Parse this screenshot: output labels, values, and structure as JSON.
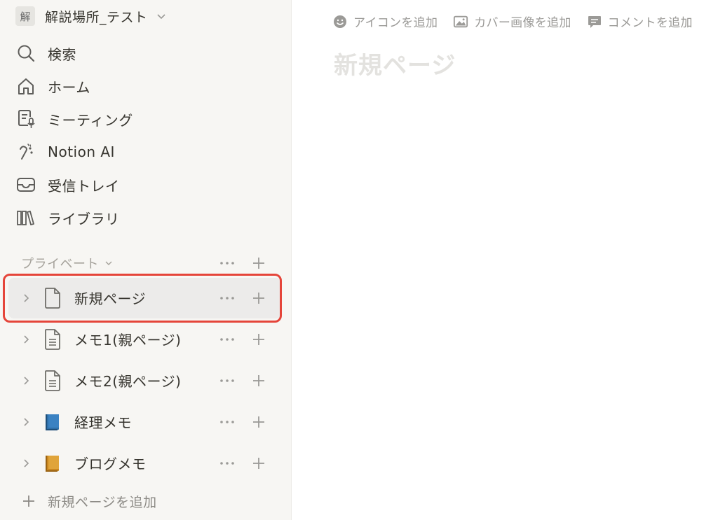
{
  "workspace": {
    "badge": "解",
    "name": "解説場所_テスト"
  },
  "nav": {
    "search": "検索",
    "home": "ホーム",
    "meetings": "ミーティング",
    "notion_ai": "Notion AI",
    "inbox": "受信トレイ",
    "library": "ライブラリ"
  },
  "private_section": {
    "label": "プライベート"
  },
  "pages": [
    {
      "label": "新規ページ",
      "icon": "page-icon",
      "selected": true
    },
    {
      "label": "メモ1(親ページ)",
      "icon": "document-icon"
    },
    {
      "label": "メモ2(親ページ)",
      "icon": "document-icon"
    },
    {
      "label": "経理メモ",
      "icon": "book-icon",
      "color": "#2e6fa8"
    },
    {
      "label": "ブログメモ",
      "icon": "book-icon",
      "color": "#d9952d"
    }
  ],
  "add_page": "新規ページを追加",
  "main": {
    "add_icon": "アイコンを追加",
    "add_cover": "カバー画像を追加",
    "add_comment": "コメントを追加",
    "title_placeholder": "新規ページ"
  },
  "colors": {
    "highlight": "#e5453a",
    "sidebar_bg": "#f7f6f3"
  }
}
